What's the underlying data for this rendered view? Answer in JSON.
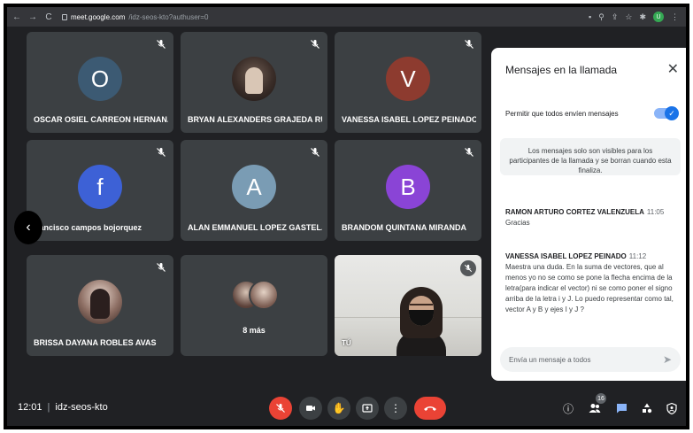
{
  "browser": {
    "url_host": "meet.google.com",
    "url_path": "/idz-seos-kto?authuser=0",
    "profile_initial": "U"
  },
  "participants": [
    {
      "name": "OSCAR OSIEL CARREON HERNAN...",
      "initial": "O",
      "avatar_color": "#3c5a73",
      "muted": true
    },
    {
      "name": "BRYAN ALEXANDERS GRAJEDA RU...",
      "initial": "",
      "avatar_color": "",
      "muted": true
    },
    {
      "name": "VANESSA ISABEL LOPEZ PEINADO",
      "initial": "V",
      "avatar_color": "#8d3b2f",
      "muted": true
    },
    {
      "name": "francisco campos bojorquez",
      "initial": "f",
      "avatar_color": "#3d61d6",
      "muted": true
    },
    {
      "name": "ALAN EMMANUEL LOPEZ GASTEL...",
      "initial": "A",
      "avatar_color": "#7a9cb4",
      "muted": true
    },
    {
      "name": "BRANDOM QUINTANA MIRANDA",
      "initial": "B",
      "avatar_color": "#8a44d6",
      "muted": true
    },
    {
      "name": "BRISSA DAYANA ROBLES AVAS",
      "initial": "",
      "avatar_color": "",
      "muted": true
    }
  ],
  "more_tile": {
    "label": "8 más"
  },
  "self_tile": {
    "label": "TÚ"
  },
  "chat": {
    "title": "Mensajes en la llamada",
    "toggle_label": "Permitir que todos envíen mensajes",
    "toggle_on": true,
    "info": "Los mensajes solo son visibles para los participantes de la llamada y se borran cuando esta finaliza.",
    "messages": [
      {
        "sender": "RAMON ARTURO CORTEZ VALENZUELA",
        "time": "11:05",
        "text": "Gracias"
      },
      {
        "sender": "VANESSA ISABEL LOPEZ PEINADO",
        "time": "11:12",
        "text": "Maestra una duda. En la suma de vectores, que al menos yo no se como se pone la flecha encima de la letra(para indicar el vector) ni se como poner el signo arriba de la letra i y J. Lo puedo representar como tal, vector A y B y ejes I y J ?"
      }
    ],
    "input_placeholder": "Envía un mensaje a todos"
  },
  "bottom_bar": {
    "time": "12:01",
    "meeting_code": "idz-seos-kto",
    "participant_count": "16"
  },
  "colors": {
    "background": "#202124",
    "tile": "#3c4043",
    "danger": "#ea4335",
    "accent": "#1a73e8"
  }
}
